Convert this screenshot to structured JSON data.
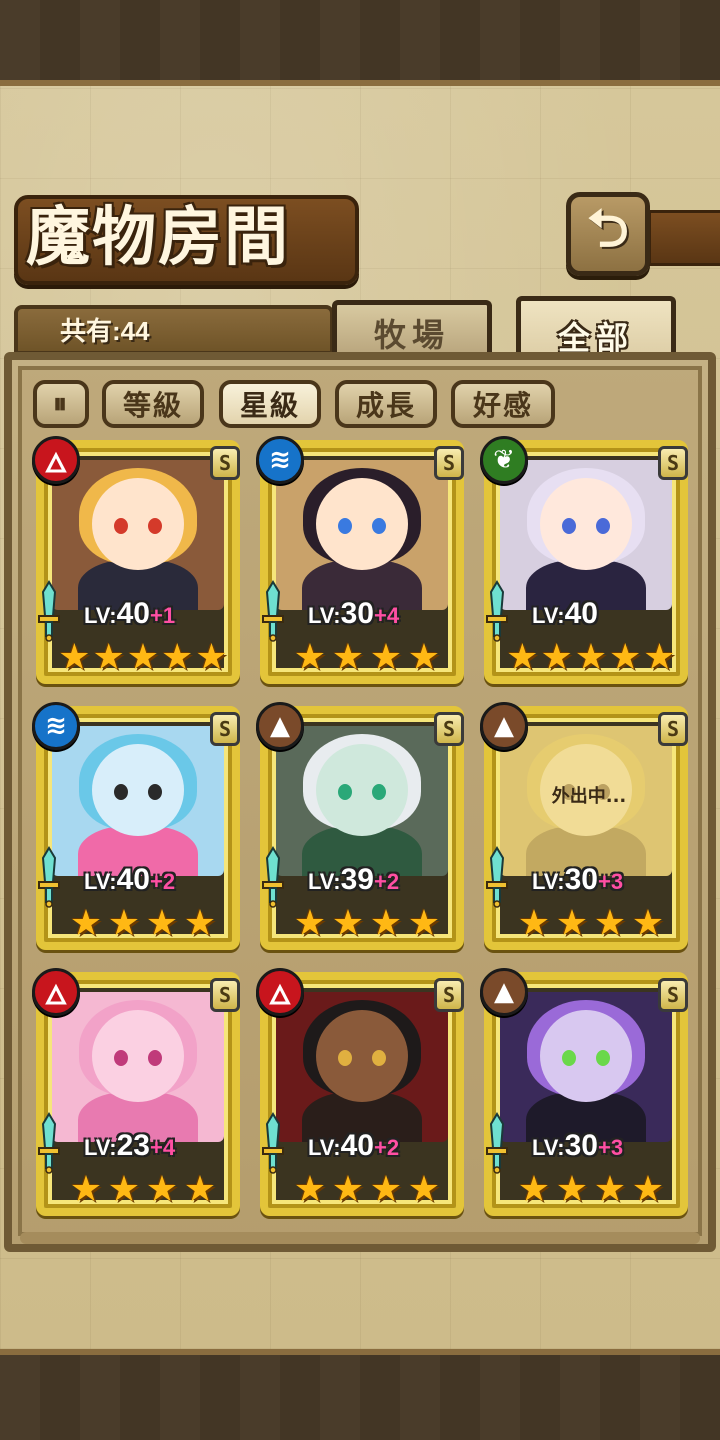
{
  "header": {
    "title": "魔物房間",
    "back_icon": "return-arrow-icon"
  },
  "count": {
    "label": "共有:44"
  },
  "tabs": [
    {
      "label": "牧場",
      "active": false
    },
    {
      "label": "全部",
      "active": true
    }
  ],
  "filters": {
    "toggle_icon": "sort-toggle-icon",
    "items": [
      {
        "label": "等級",
        "active": false
      },
      {
        "label": "星級",
        "active": true
      },
      {
        "label": "成長",
        "active": false
      },
      {
        "label": "好感",
        "active": false
      }
    ]
  },
  "colors": {
    "fire": "#c8151d",
    "water": "#1673c9",
    "wood": "#2f7d22",
    "earth": "#7a4a2a",
    "frame_gold": "#e3c53a",
    "plus_pink": "#ff4fa3"
  },
  "monsters": [
    {
      "element": "fire",
      "element_glyph": "🜂",
      "rank": "S",
      "level": "40",
      "plus": "+1",
      "stars": 5,
      "status": ""
    },
    {
      "element": "water",
      "element_glyph": "≋",
      "rank": "S",
      "level": "30",
      "plus": "+4",
      "stars": 4,
      "status": ""
    },
    {
      "element": "wood",
      "element_glyph": "❦",
      "rank": "S",
      "level": "40",
      "plus": "",
      "stars": 5,
      "status": ""
    },
    {
      "element": "water",
      "element_glyph": "≋",
      "rank": "S",
      "level": "40",
      "plus": "+2",
      "stars": 4,
      "status": ""
    },
    {
      "element": "earth",
      "element_glyph": "▲",
      "rank": "S",
      "level": "39",
      "plus": "+2",
      "stars": 4,
      "status": ""
    },
    {
      "element": "earth",
      "element_glyph": "▲",
      "rank": "S",
      "level": "30",
      "plus": "+3",
      "stars": 4,
      "status": "外出中..."
    },
    {
      "element": "fire",
      "element_glyph": "🜂",
      "rank": "S",
      "level": "23",
      "plus": "+4",
      "stars": 4,
      "status": ""
    },
    {
      "element": "fire",
      "element_glyph": "🜂",
      "rank": "S",
      "level": "40",
      "plus": "+2",
      "stars": 4,
      "status": ""
    },
    {
      "element": "earth",
      "element_glyph": "▲",
      "rank": "S",
      "level": "30",
      "plus": "+3",
      "stars": 4,
      "status": ""
    }
  ],
  "level_prefix": "LV:"
}
